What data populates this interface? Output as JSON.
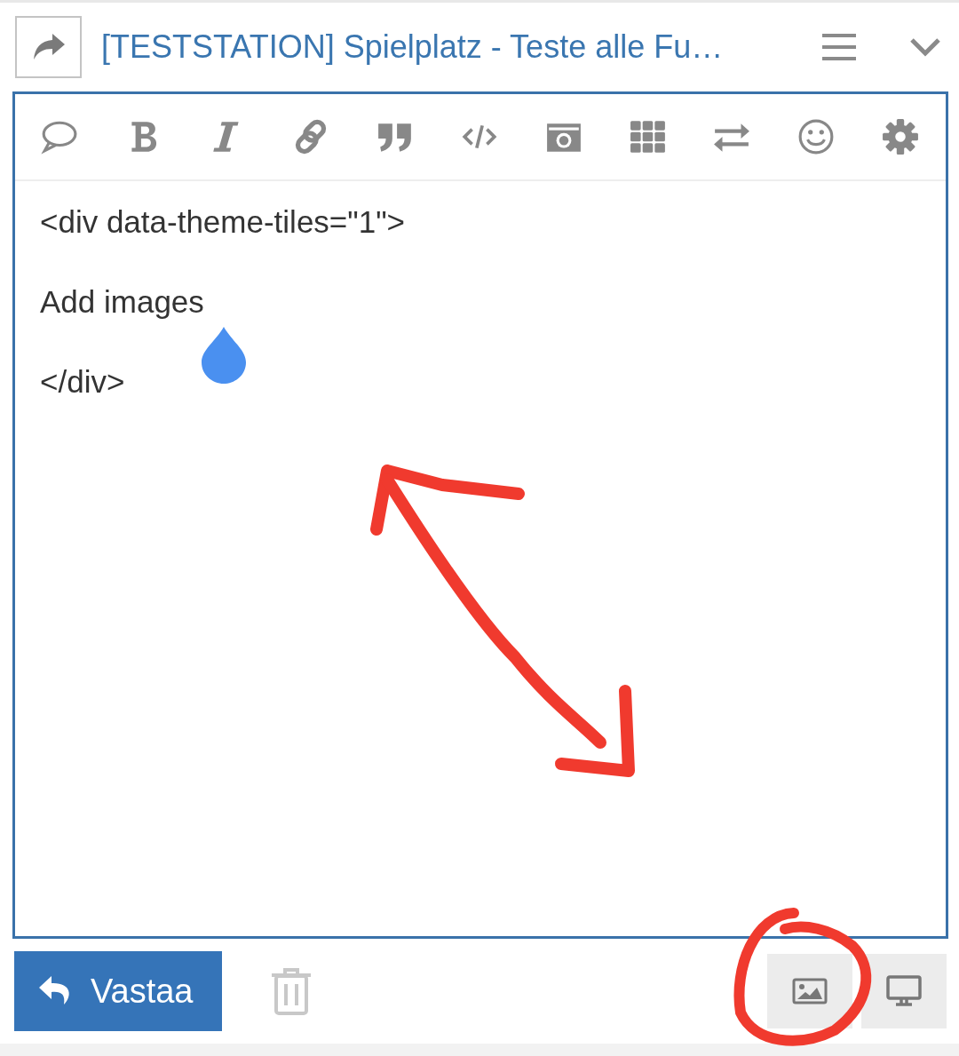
{
  "header": {
    "title": "[TESTSTATION] Spielplatz - Teste alle Fu…"
  },
  "editor": {
    "lines": [
      "<div data-theme-tiles=\"1\">",
      "Add images",
      "</div>"
    ]
  },
  "footer": {
    "reply_label": "Vastaa"
  }
}
